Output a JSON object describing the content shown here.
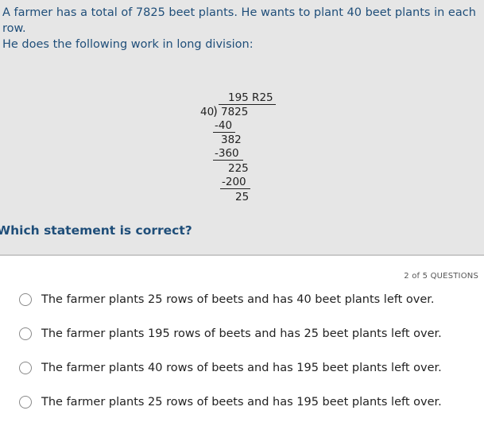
{
  "question": {
    "prompt_line1": "A farmer has a total of 7825 beet plants. He wants to plant 40 beet plants in each row.",
    "prompt_line2": "He does the following work in long division:",
    "stem": "Which statement is correct?"
  },
  "long_division": {
    "quotient": "195 R25",
    "divisor": "40",
    "dividend": "7825",
    "step1_subtract": "-40",
    "step1_remainder": "382",
    "step2_subtract": "-360",
    "step2_remainder": "225",
    "step3_subtract": "-200",
    "final_remainder": "25"
  },
  "progress": {
    "label": "2 of 5 QUESTIONS"
  },
  "options": [
    {
      "label": "The farmer plants 25 rows of beets and has 40 beet plants left over."
    },
    {
      "label": "The farmer plants 195 rows of beets and has 25 beet plants left over."
    },
    {
      "label": "The farmer plants 40 rows of beets and has 195 beet plants left over."
    },
    {
      "label": "The farmer plants 25 rows of beets and has 195 beet plants left over."
    }
  ]
}
